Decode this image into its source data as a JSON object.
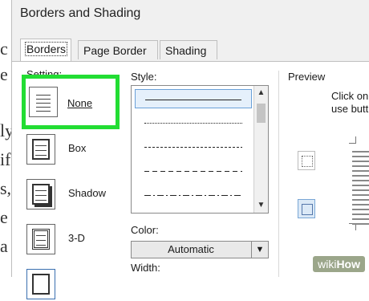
{
  "dialog": {
    "title": "Borders and Shading"
  },
  "tabs": [
    {
      "label": "Borders",
      "active": true
    },
    {
      "label": "Page Border",
      "active": false
    },
    {
      "label": "Shading",
      "active": false
    }
  ],
  "settings": {
    "label": "Setting:",
    "items": [
      {
        "label": "None",
        "icon": "border-none-icon",
        "selected": true
      },
      {
        "label": "Box",
        "icon": "border-box-icon",
        "selected": false
      },
      {
        "label": "Shadow",
        "icon": "border-shadow-icon",
        "selected": false
      },
      {
        "label": "3-D",
        "icon": "border-3d-icon",
        "selected": false
      }
    ]
  },
  "style": {
    "label": "Style:",
    "options": [
      "solid",
      "dotted",
      "dashed-small",
      "dashed",
      "dash-dot",
      "dash-dot-dot"
    ],
    "selected_index": 0
  },
  "color": {
    "label": "Color:",
    "value": "Automatic"
  },
  "width": {
    "label": "Width:"
  },
  "preview": {
    "label": "Preview",
    "hint_line1": "Click on",
    "hint_line2": "use butt"
  },
  "background_text": [
    "c",
    "e",
    "ly",
    "if",
    "s,",
    "e",
    "a"
  ],
  "watermark": {
    "wiki": "wiki",
    "how": "How"
  },
  "colors": {
    "highlight": "#22dd33",
    "selection": "#e5f0fb",
    "selection_border": "#6aa0d8"
  }
}
